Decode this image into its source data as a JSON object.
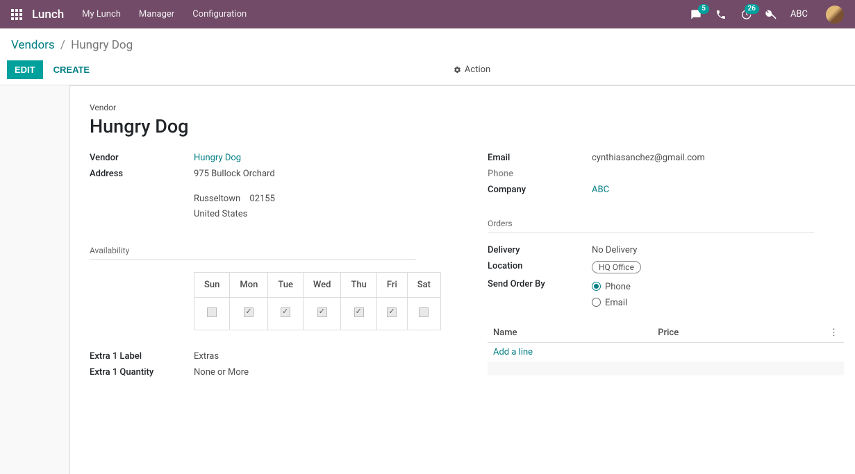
{
  "navbar": {
    "brand": "Lunch",
    "menu": [
      "My Lunch",
      "Manager",
      "Configuration"
    ],
    "messaging_badge": "5",
    "clock_badge": "26",
    "user": "ABC"
  },
  "breadcrumb": {
    "parent": "Vendors",
    "active": "Hungry Dog"
  },
  "buttons": {
    "edit": "EDIT",
    "create": "CREATE",
    "action": "Action"
  },
  "form": {
    "title_label": "Vendor",
    "title": "Hungry Dog",
    "left": {
      "vendor_label": "Vendor",
      "vendor_value": "Hungry Dog",
      "address_label": "Address",
      "address_street": "975 Bullock Orchard",
      "address_city": "Russeltown",
      "address_zip": "02155",
      "address_country": "United States"
    },
    "right": {
      "email_label": "Email",
      "email_value": "cynthiasanchez@gmail.com",
      "phone_label": "Phone",
      "phone_value": "",
      "company_label": "Company",
      "company_value": "ABC"
    },
    "availability": {
      "separator": "Availability",
      "days": [
        "Sun",
        "Mon",
        "Tue",
        "Wed",
        "Thu",
        "Fri",
        "Sat"
      ],
      "checked": [
        false,
        true,
        true,
        true,
        true,
        true,
        false
      ]
    },
    "extras": {
      "extra1_label_label": "Extra 1 Label",
      "extra1_label_value": "Extras",
      "extra1_qty_label": "Extra 1 Quantity",
      "extra1_qty_value": "None or More"
    },
    "orders": {
      "separator": "Orders",
      "delivery_label": "Delivery",
      "delivery_value": "No Delivery",
      "location_label": "Location",
      "location_tag": "HQ Office",
      "sendby_label": "Send Order By",
      "sendby_options": [
        "Phone",
        "Email"
      ],
      "sendby_selected": "Phone"
    },
    "line_table": {
      "cols": [
        "Name",
        "Price"
      ],
      "add_line": "Add a line"
    }
  }
}
